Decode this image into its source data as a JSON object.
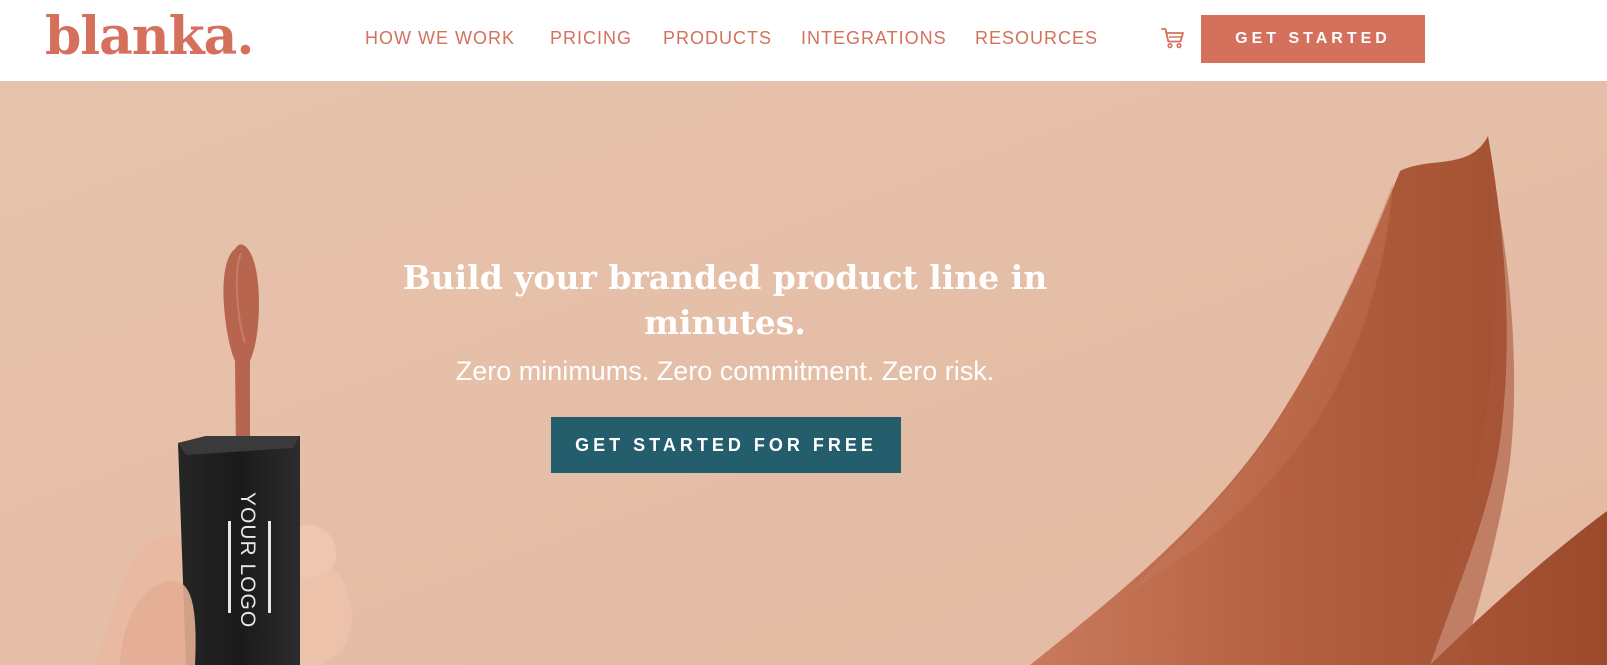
{
  "header": {
    "logo": "blanka.",
    "nav": [
      {
        "label": "HOW WE WORK"
      },
      {
        "label": "PRICING"
      },
      {
        "label": "PRODUCTS"
      },
      {
        "label": "INTEGRATIONS"
      },
      {
        "label": "RESOURCES"
      }
    ],
    "cart_icon": "shopping-cart-icon",
    "cta_label": "GET STARTED"
  },
  "hero": {
    "headline": "Build your branded product line in minutes.",
    "subheadline": "Zero minimums. Zero commitment. Zero risk.",
    "cta_label": "GET STARTED FOR FREE",
    "product_logo_text": "YOUR LOGO"
  },
  "colors": {
    "brand": "#d4705c",
    "hero_bg": "#e6c1ab",
    "hero_button": "#245e6d",
    "swatch": "#b8664a"
  }
}
